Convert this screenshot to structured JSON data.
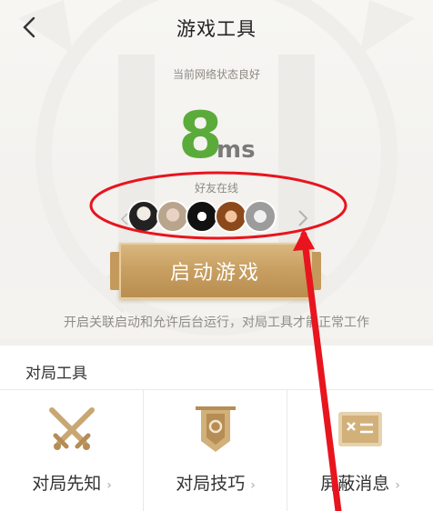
{
  "header": {
    "title": "游戏工具",
    "back_icon": "chevron-left-icon"
  },
  "network": {
    "status_text": "当前网络状态良好",
    "ping_value": "8",
    "ping_unit": "ms",
    "ping_color": "#5bab3a"
  },
  "friends": {
    "label": "好友在线",
    "avatars": [
      "friend-1",
      "friend-2",
      "friend-3",
      "friend-4",
      "friend-5"
    ],
    "next_icon": "chevron-right-icon"
  },
  "launch": {
    "label": "启动游戏",
    "accent": "#c8a062"
  },
  "tip": {
    "text": "开启关联启动和允许后台运行，对局工具才能正常工作"
  },
  "tools_section": {
    "title": "对局工具",
    "items": [
      {
        "label": "对局先知",
        "icon": "crossed-swords-icon"
      },
      {
        "label": "对局技巧",
        "icon": "banner-shield-icon"
      },
      {
        "label": "屏蔽消息",
        "icon": "message-card-icon"
      }
    ],
    "chevron": "›"
  },
  "annotation": {
    "color": "#e8141e"
  }
}
